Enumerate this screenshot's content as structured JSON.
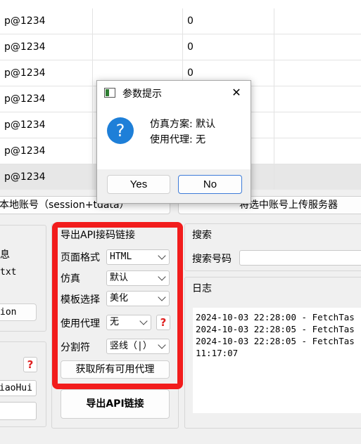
{
  "table": {
    "rows": [
      {
        "col1": "p@1234",
        "col3": "0",
        "selected": false
      },
      {
        "col1": "p@1234",
        "col3": "0",
        "selected": false
      },
      {
        "col1": "p@1234",
        "col3": "0",
        "selected": false
      },
      {
        "col1": "p@1234",
        "col3": "",
        "selected": false
      },
      {
        "col1": "p@1234",
        "col3": "",
        "selected": false
      },
      {
        "col1": "p@1234",
        "col3": "",
        "selected": false
      },
      {
        "col1": "p@1234",
        "col3": "",
        "selected": true
      }
    ]
  },
  "actions": {
    "local_accounts": "本地账号（session+tdata）",
    "upload_selected": "将选中账号上传服务器"
  },
  "left_panel": {
    "label_info": "息",
    "label_txt": "txt",
    "button_ion": "ion",
    "field_value": "iaoHui"
  },
  "export": {
    "title": "导出API接码链接",
    "page_format_label": "页面格式",
    "page_format_value": "HTML",
    "simulation_label": "仿真",
    "simulation_value": "默认",
    "template_label": "模板选择",
    "template_value": "美化",
    "proxy_label": "使用代理",
    "proxy_value": "无",
    "separator_label": "分割符",
    "separator_value": "竖线（|）",
    "get_proxies_button": "获取所有可用代理",
    "export_button": "导出API链接",
    "help_symbol": "?"
  },
  "search": {
    "title": "搜索",
    "number_label": "搜索号码"
  },
  "log": {
    "title": "日志",
    "lines": "2024-10-03 22:28:00 - FetchTas\n2024-10-03 22:28:05 - FetchTas\n2024-10-03 22:28:05 - FetchTas\n11:17:07"
  },
  "dialog": {
    "title": "参数提示",
    "line1": "仿真方案: 默认",
    "line2": "使用代理: 无",
    "yes": "Yes",
    "no": "No",
    "info_symbol": "?",
    "close_symbol": "✕"
  },
  "colors": {
    "highlight_border": "#f21c1c",
    "dialog_icon": "#1e7fd8",
    "help_icon": "#e02020"
  }
}
